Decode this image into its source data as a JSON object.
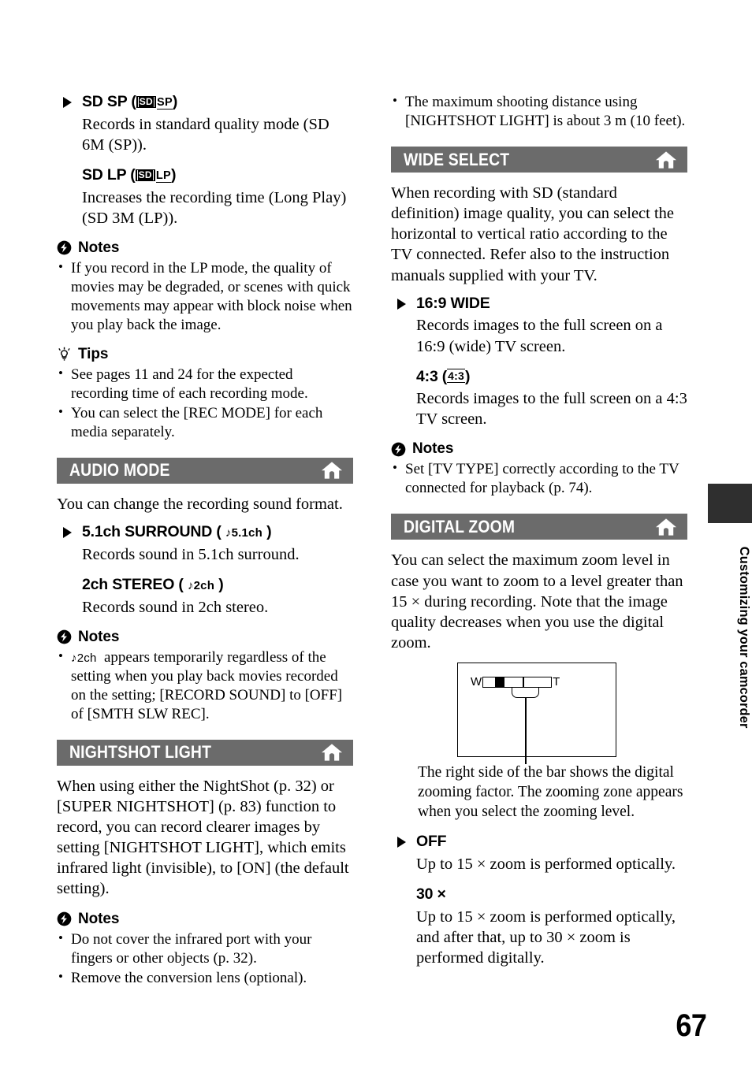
{
  "page": {
    "number": "67",
    "side_tab_label": "Customizing your camcorder",
    "home_icon_name": "home-icon"
  },
  "left_column": {
    "rec_mode_options": [
      {
        "label": "SD SP (",
        "badge": "SD",
        "badge_suffix": "SP",
        "label_close": ")",
        "selected": true,
        "description": "Records in standard quality mode (SD 6M (SP))."
      },
      {
        "label": "SD LP (",
        "badge": "SD",
        "badge_suffix": "LP",
        "label_close": ")",
        "selected": false,
        "description": "Increases the recording time (Long Play) (SD 3M (LP))."
      }
    ],
    "notes_1": {
      "heading": "Notes",
      "items": [
        "If you record in the LP mode, the quality of movies may be degraded, or scenes with quick movements may appear with block noise when you play back the image."
      ]
    },
    "tips_1": {
      "heading": "Tips",
      "items": [
        "See pages 11 and 24 for the expected recording time of each recording mode.",
        "You can select the [REC MODE] for each media separately."
      ]
    },
    "audio_mode": {
      "title": "AUDIO MODE",
      "intro": "You can change the recording sound format.",
      "options": [
        {
          "label": "5.1ch SURROUND ( ",
          "glyph": "♪5.1ch",
          "label_close": " )",
          "selected": true,
          "description": "Records sound in 5.1ch surround."
        },
        {
          "label": "2ch STEREO ( ",
          "glyph": "♪2ch",
          "label_close": " )",
          "selected": false,
          "description": "Records sound in 2ch stereo."
        }
      ],
      "notes": {
        "heading": "Notes",
        "glyph": "♪2ch",
        "item_text": "appears temporarily regardless of the setting when you play back movies recorded on the setting; [RECORD SOUND] to [OFF] of [SMTH SLW REC]."
      }
    },
    "nightshot_light": {
      "title": "NIGHTSHOT LIGHT",
      "intro": "When using either the NightShot (p. 32) or [SUPER NIGHTSHOT] (p. 83) function to record, you can record clearer images by setting [NIGHTSHOT LIGHT], which emits infrared light (invisible), to [ON] (the default setting).",
      "notes": {
        "heading": "Notes",
        "items": [
          "Do not cover the infrared port with your fingers or other objects (p. 32).",
          "Remove the conversion lens (optional)."
        ]
      }
    }
  },
  "right_column": {
    "top_bullets": [
      "The maximum shooting distance using [NIGHTSHOT LIGHT] is about 3 m (10 feet)."
    ],
    "wide_select": {
      "title": "WIDE SELECT",
      "intro": "When recording with SD (standard definition) image quality, you can select the horizontal to vertical ratio according to the TV connected. Refer also to the instruction manuals supplied with your TV.",
      "options": [
        {
          "label": "16:9 WIDE",
          "selected": true,
          "description": "Records images to the full screen on a 16:9 (wide) TV screen."
        },
        {
          "label": "4:3 (",
          "glyph": "4:3",
          "label_close": ")",
          "selected": false,
          "description": "Records images to the full screen on a 4:3 TV screen."
        }
      ],
      "notes": {
        "heading": "Notes",
        "items": [
          "Set [TV TYPE] correctly according to the TV connected for playback (p. 74)."
        ]
      }
    },
    "digital_zoom": {
      "title": "DIGITAL ZOOM",
      "intro": "You can select the maximum zoom level in case you want to zoom to a level greater than 15 × during recording. Note that the image quality decreases when you use the digital zoom.",
      "figure": {
        "wide_label": "W",
        "tele_label": "T",
        "caption": "The right side of the bar shows the digital zooming factor. The zooming zone appears when you select the zooming level."
      },
      "options": [
        {
          "label": "OFF",
          "selected": true,
          "description": "Up to 15 × zoom is performed optically."
        },
        {
          "label": "30 ×",
          "selected": false,
          "description": "Up to 15 × zoom is performed optically, and after that, up to 30 × zoom is performed digitally."
        }
      ]
    }
  },
  "colors": {
    "section_bar": "#6b6b6b",
    "side_tab": "#2f2f2f",
    "text": "#000000"
  }
}
